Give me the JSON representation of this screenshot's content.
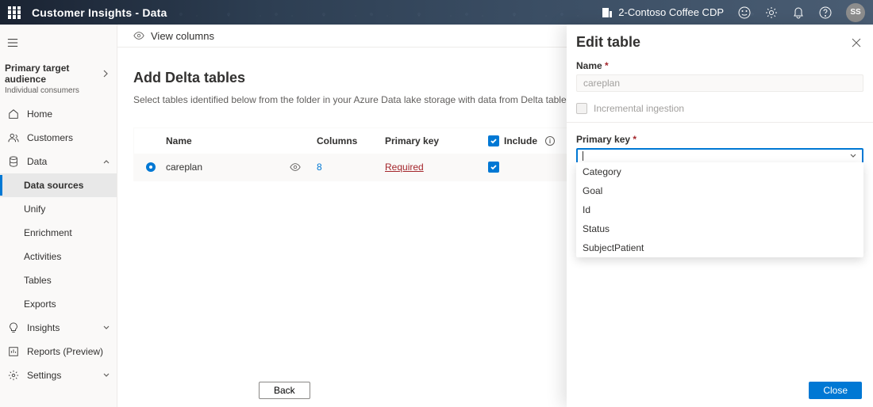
{
  "topbar": {
    "brand": "Customer Insights - Data",
    "org": "2-Contoso Coffee CDP",
    "avatar_initials": "SS"
  },
  "sidebar": {
    "audience_label": "Primary target audience",
    "audience_sub": "Individual consumers",
    "items": [
      {
        "label": "Home"
      },
      {
        "label": "Customers"
      },
      {
        "label": "Data",
        "expanded": true
      },
      {
        "label": "Data sources",
        "sub": true,
        "selected": true
      },
      {
        "label": "Unify",
        "sub": true
      },
      {
        "label": "Enrichment",
        "sub": true
      },
      {
        "label": "Activities",
        "sub": true
      },
      {
        "label": "Tables",
        "sub": true
      },
      {
        "label": "Exports",
        "sub": true
      },
      {
        "label": "Insights"
      },
      {
        "label": "Reports (Preview)"
      },
      {
        "label": "Settings"
      }
    ]
  },
  "content": {
    "view_columns": "View columns",
    "title": "Add Delta tables",
    "subtitle": "Select tables identified below from the folder in your Azure Data lake storage with data from Delta tables.",
    "headers": {
      "name": "Name",
      "columns": "Columns",
      "primary_key": "Primary key",
      "include": "Include"
    },
    "row": {
      "name": "careplan",
      "columns": "8",
      "primary_key": "Required"
    },
    "back": "Back"
  },
  "panel": {
    "title": "Edit table",
    "name_label": "Name",
    "name_value": "careplan",
    "incremental_label": "Incremental ingestion",
    "pk_label": "Primary key",
    "dropdown": [
      "Category",
      "Goal",
      "Id",
      "Status",
      "SubjectPatient"
    ],
    "close": "Close"
  }
}
